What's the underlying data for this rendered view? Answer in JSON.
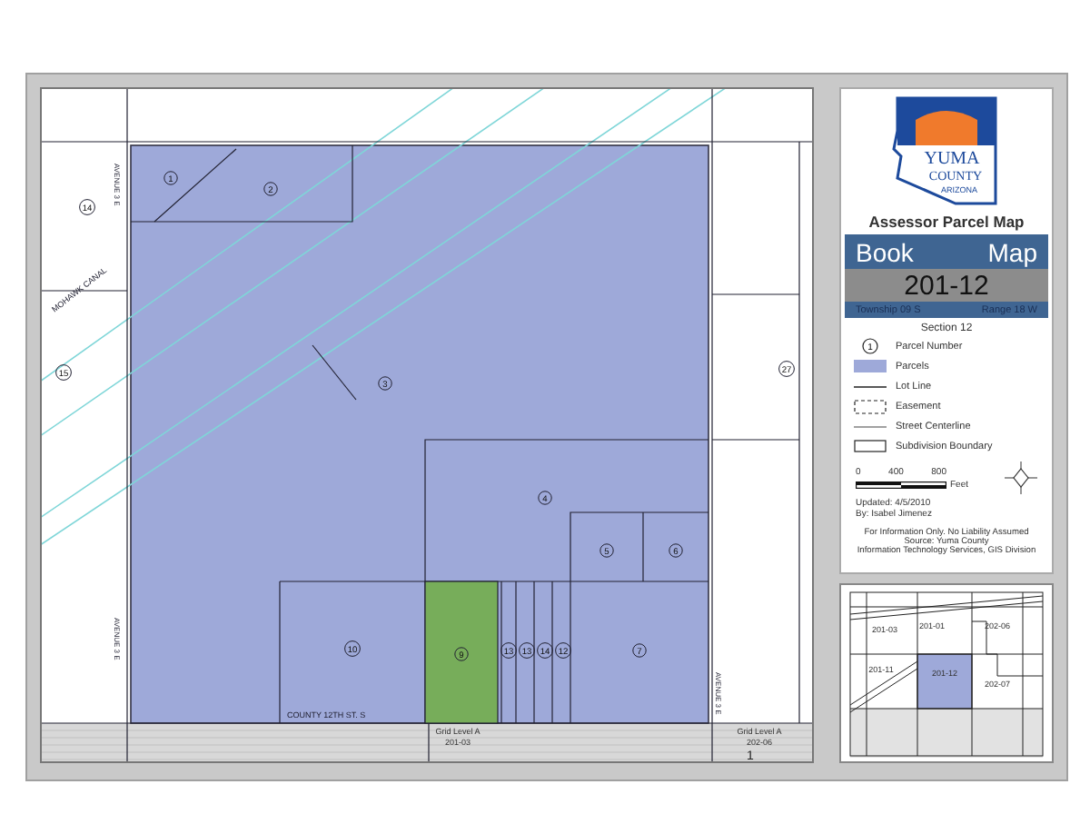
{
  "map": {
    "parcels": [
      {
        "number": "1",
        "highlighted": false
      },
      {
        "number": "2",
        "highlighted": false
      },
      {
        "number": "3",
        "highlighted": false
      },
      {
        "number": "4",
        "highlighted": false
      },
      {
        "number": "5",
        "highlighted": false
      },
      {
        "number": "6",
        "highlighted": false
      },
      {
        "number": "7",
        "highlighted": false
      },
      {
        "number": "9",
        "highlighted": true
      },
      {
        "number": "10",
        "highlighted": false
      },
      {
        "number": "13",
        "highlighted": false
      },
      {
        "number": "13",
        "highlighted": false
      },
      {
        "number": "14",
        "highlighted": false
      },
      {
        "number": "12",
        "highlighted": false
      },
      {
        "number": "14",
        "highlighted": false
      },
      {
        "number": "15",
        "highlighted": false
      },
      {
        "number": "27",
        "highlighted": false
      }
    ],
    "canal": "MOHAWK CANAL",
    "streets": [
      "AVENUE 3 E",
      "AVENUE 3 E",
      "COUNTY 12TH ST. S",
      "AVENUE 3 E"
    ],
    "grid_labels": [
      {
        "level": "Grid Level A",
        "book": "201-03"
      },
      {
        "level": "Grid Level A",
        "book": "202-06"
      }
    ],
    "page_number": "1"
  },
  "panel": {
    "logo": {
      "line_1": "YUMA",
      "line_2": "COUNTY",
      "line_3": "ARIZONA"
    },
    "title": "Assessor Parcel Map",
    "book_label": "Book",
    "map_label": "Map",
    "number": "201-12",
    "township": "Township 09 S",
    "range": "Range 18 W",
    "section": "Section 12",
    "legend": [
      {
        "kind": "parcel-number",
        "symbol": "1",
        "label": "Parcel Number"
      },
      {
        "kind": "parcels",
        "label": "Parcels"
      },
      {
        "kind": "lot-line",
        "label": "Lot Line"
      },
      {
        "kind": "easement",
        "label": "Easement"
      },
      {
        "kind": "street-centerline",
        "label": "Street Centerline"
      },
      {
        "kind": "subdivision-boundary",
        "label": "Subdivision Boundary"
      }
    ],
    "scale": {
      "ticks": [
        "0",
        "400",
        "800"
      ],
      "unit": "Feet"
    },
    "updated": "Updated: 4/5/2010",
    "author": "By: Isabel Jimenez",
    "notes": [
      "For Information Only. No Liability Assumed",
      "Source: Yuma County",
      "Information Technology Services, GIS Division"
    ]
  },
  "inset": {
    "labels": [
      "201-03",
      "201-01",
      "202-06",
      "201-11",
      "201-12",
      "202-07"
    ]
  }
}
